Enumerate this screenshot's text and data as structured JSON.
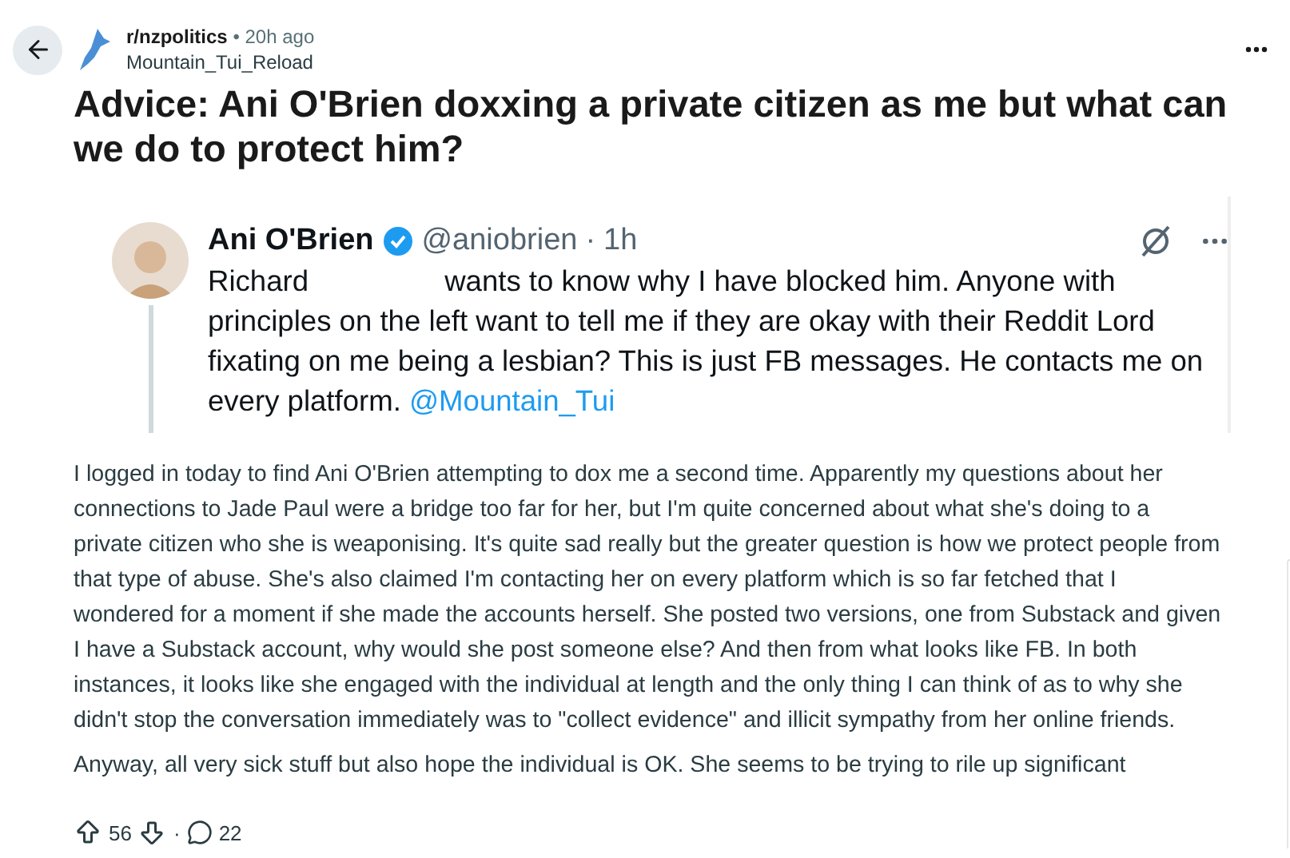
{
  "post": {
    "subreddit": "r/nzpolitics",
    "separator": "•",
    "time": "20h ago",
    "author": "Mountain_Tui_Reload",
    "title": "Advice: Ani O'Brien doxxing a private citizen as me but what can we do to protect him?"
  },
  "tweet": {
    "name": "Ani O'Brien",
    "verified": true,
    "handle": "@aniobrien",
    "separator": "·",
    "time": "1h",
    "text_start": "Richard",
    "text_rest": "wants to know why I have blocked him. Anyone with principles on the left want to tell me if they are okay with their Reddit Lord fixating on me being a lesbian? This is just FB messages. He contacts me on every platform.",
    "mention": "@Mountain_Tui"
  },
  "body": [
    "I logged in today to find Ani O'Brien attempting to dox me a second time. Apparently my questions about her connections to Jade Paul were a bridge too far for her, but I'm quite concerned about what she's doing to a private citizen who she is weaponising. It's quite sad really but the greater question is how we protect people from that type of abuse. She's also claimed I'm contacting her on every platform which is so far fetched that I wondered for a moment if she made the accounts herself. She posted two versions, one from Substack and given I have a Substack account, why would she post someone else? And then from what looks like FB. In both instances, it looks like she engaged with the individual at length and the only thing I can think of as to why she didn't stop the conversation immediately was to \"collect evidence\" and illicit sympathy from her online friends.",
    "Anyway, all very sick stuff but also hope the individual is OK. She seems to be trying to rile up significant"
  ],
  "footer": {
    "upvotes": "56",
    "separator": "·",
    "comments": "22"
  }
}
